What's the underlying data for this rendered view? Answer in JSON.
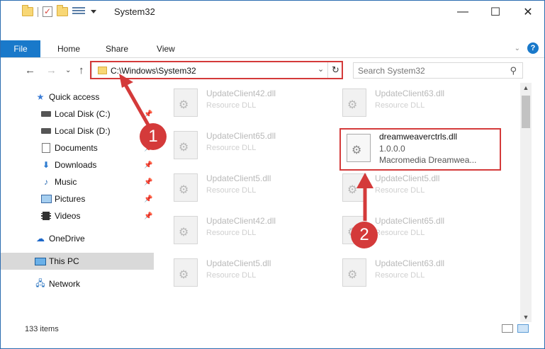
{
  "window": {
    "title": "System32",
    "controls": {
      "minimize": "—",
      "maximize": "☐",
      "close": "✕"
    }
  },
  "ribbon": {
    "tabs": [
      "File",
      "Home",
      "Share",
      "View"
    ],
    "help": "?"
  },
  "address": {
    "path": "C:\\Windows\\System32",
    "search_placeholder": "Search System32"
  },
  "sidebar": {
    "items": [
      {
        "label": "Quick access",
        "icon": "star-icon"
      },
      {
        "label": "Local Disk (C:)",
        "icon": "drive-icon"
      },
      {
        "label": "Local Disk (D:)",
        "icon": "drive-icon"
      },
      {
        "label": "Documents",
        "icon": "documents-icon"
      },
      {
        "label": "Downloads",
        "icon": "download-icon"
      },
      {
        "label": "Music",
        "icon": "music-icon"
      },
      {
        "label": "Pictures",
        "icon": "pictures-icon"
      },
      {
        "label": "Videos",
        "icon": "videos-icon"
      },
      {
        "label": "OneDrive",
        "icon": "cloud-icon"
      },
      {
        "label": "This PC",
        "icon": "computer-icon"
      },
      {
        "label": "Network",
        "icon": "network-icon"
      }
    ]
  },
  "files": [
    {
      "name": "UpdateClient42.dll",
      "type": "Resource DLL"
    },
    {
      "name": "UpdateClient63.dll",
      "type": "Resource DLL"
    },
    {
      "name": "UpdateClient65.dll",
      "type": "Resource DLL"
    },
    {
      "name": "dreamweaverctrls.dll",
      "version": "1.0.0.0",
      "description": "Macromedia Dreamwea..."
    },
    {
      "name": "UpdateClient5.dll",
      "type": "Resource DLL"
    },
    {
      "name": "UpdateClient5.dll",
      "type": "Resource DLL"
    },
    {
      "name": "UpdateClient42.dll",
      "type": "Resource DLL"
    },
    {
      "name": "UpdateClient65.dll",
      "type": "Resource DLL"
    },
    {
      "name": "UpdateClient5.dll",
      "type": "Resource DLL"
    },
    {
      "name": "UpdateClient63.dll",
      "type": "Resource DLL"
    }
  ],
  "status": {
    "item_count": "133 items"
  },
  "annotations": {
    "marker1": "1",
    "marker2": "2",
    "color": "#d43a3a"
  }
}
